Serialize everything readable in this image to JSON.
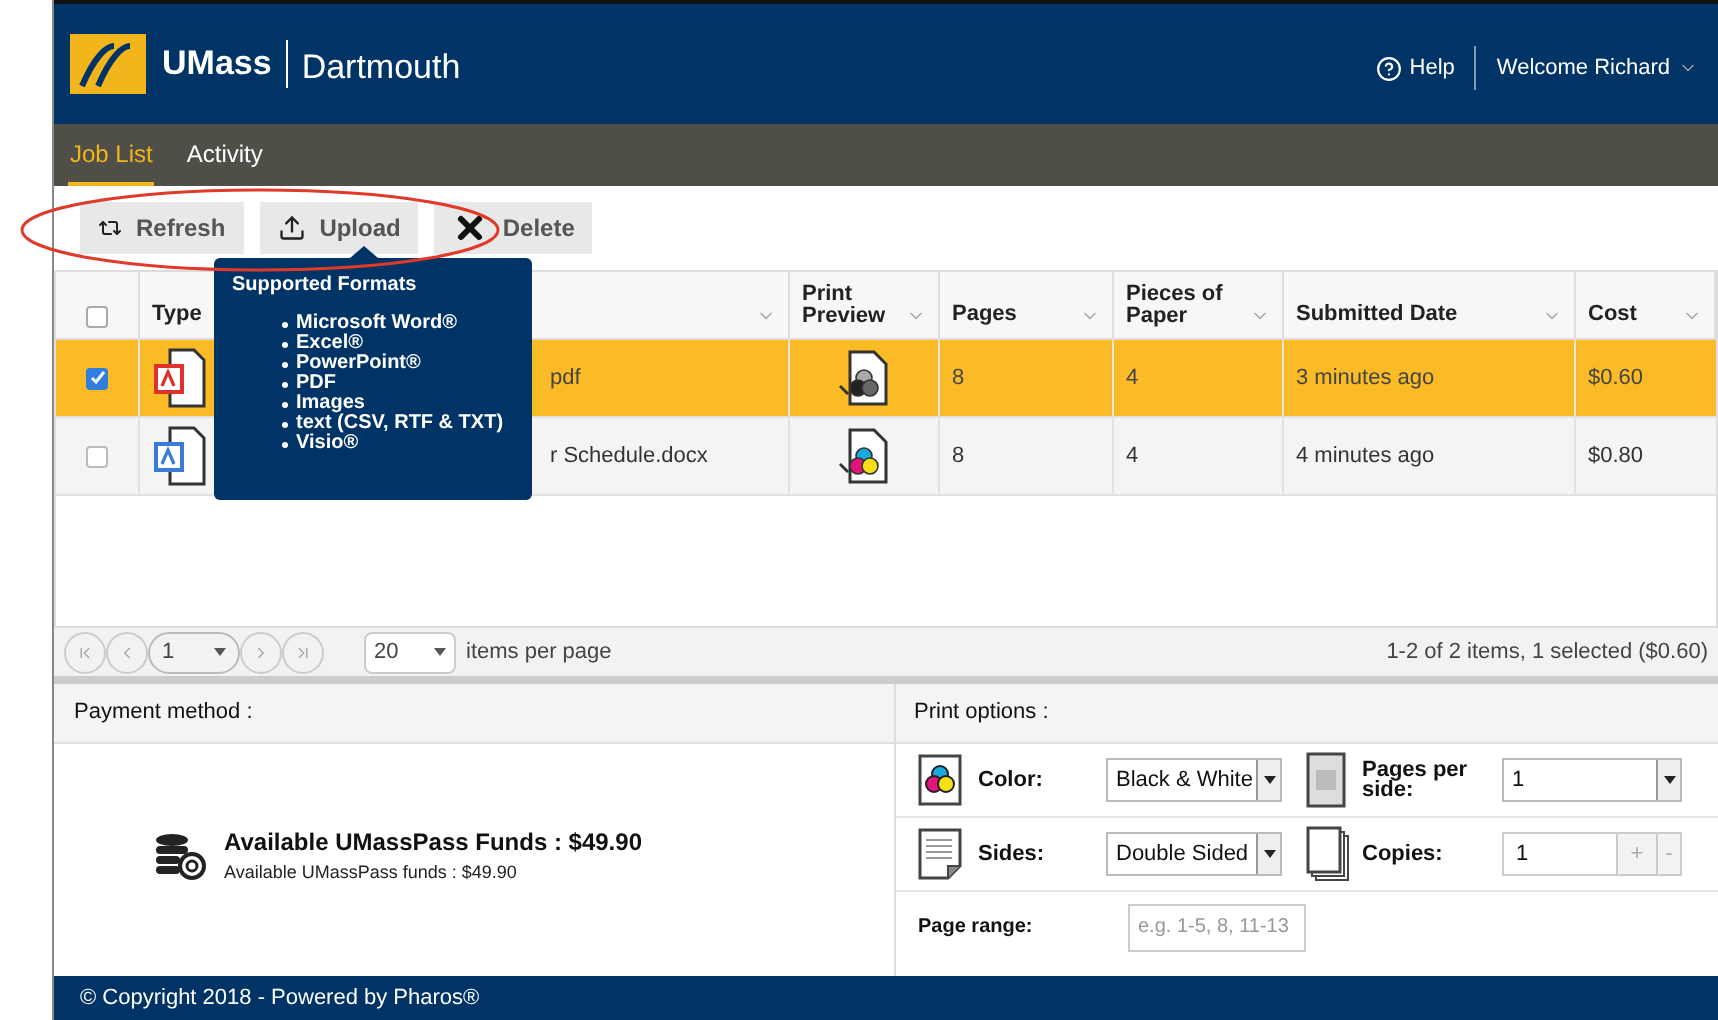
{
  "header": {
    "logo_main": "UMass",
    "logo_sub": "Dartmouth",
    "help": "Help",
    "user": "Welcome Richard"
  },
  "tabs": [
    {
      "label": "Job List",
      "selected": true
    },
    {
      "label": "Activity",
      "selected": false
    }
  ],
  "toolbar": [
    {
      "kind": "refresh",
      "label": "Refresh"
    },
    {
      "kind": "upload",
      "label": "Upload"
    },
    {
      "kind": "delete",
      "label": "Delete"
    }
  ],
  "tooltip": {
    "title": "Supported Formats",
    "items": [
      "Microsoft Word®",
      "Excel®",
      "PowerPoint®",
      "PDF",
      "Images",
      "text (CSV, RTF & TXT)",
      "Visio®"
    ]
  },
  "table": {
    "header_checkbox": {
      "checked": false
    },
    "columns": [
      {
        "label": "Type",
        "sortable": false
      },
      {
        "sortable": true
      },
      {
        "label": "Print Preview",
        "sortable": true
      },
      {
        "label": "Pages",
        "sortable": true
      },
      {
        "label": "Pieces of Paper",
        "sortable": true
      },
      {
        "label": "Submitted Date",
        "sortable": true
      },
      {
        "label": "Cost",
        "sortable": true
      }
    ],
    "rows": [
      {
        "selected": true,
        "file": {
          "kind": "pdf"
        },
        "name": "pdf",
        "preview": {
          "kind": "mono"
        },
        "pages": "8",
        "pieces": "4",
        "submitted": "3 minutes ago",
        "cost": "$0.60"
      },
      {
        "selected": false,
        "file": {
          "kind": "word"
        },
        "name": "r Schedule.docx",
        "preview": {
          "kind": "color"
        },
        "pages": "8",
        "pieces": "4",
        "submitted": "4 minutes ago",
        "cost": "$0.80"
      }
    ]
  },
  "pager": {
    "page": "1",
    "page_size": "20",
    "page_size_label": "items per page",
    "summary": "1-2 of 2 items, 1 selected ($0.60)"
  },
  "payment": {
    "title": "Payment method :",
    "funds_title": "Available UMassPass Funds : $49.90",
    "funds_detail": "Available UMassPass funds : $49.90"
  },
  "print_options": {
    "title": "Print options :",
    "color": {
      "label": "Color:",
      "value": "Black & White"
    },
    "pages_per_side": {
      "label": "Pages per side:",
      "value": "1"
    },
    "sides": {
      "label": "Sides:",
      "value": "Double Sided"
    },
    "copies": {
      "label": "Copies:",
      "value": "1",
      "plus": "+",
      "minus": "-"
    },
    "page_range": {
      "label": "Page range:",
      "placeholder": "e.g. 1-5, 8, 11-13"
    }
  },
  "footer": "© Copyright 2018 - Powered by Pharos®"
}
